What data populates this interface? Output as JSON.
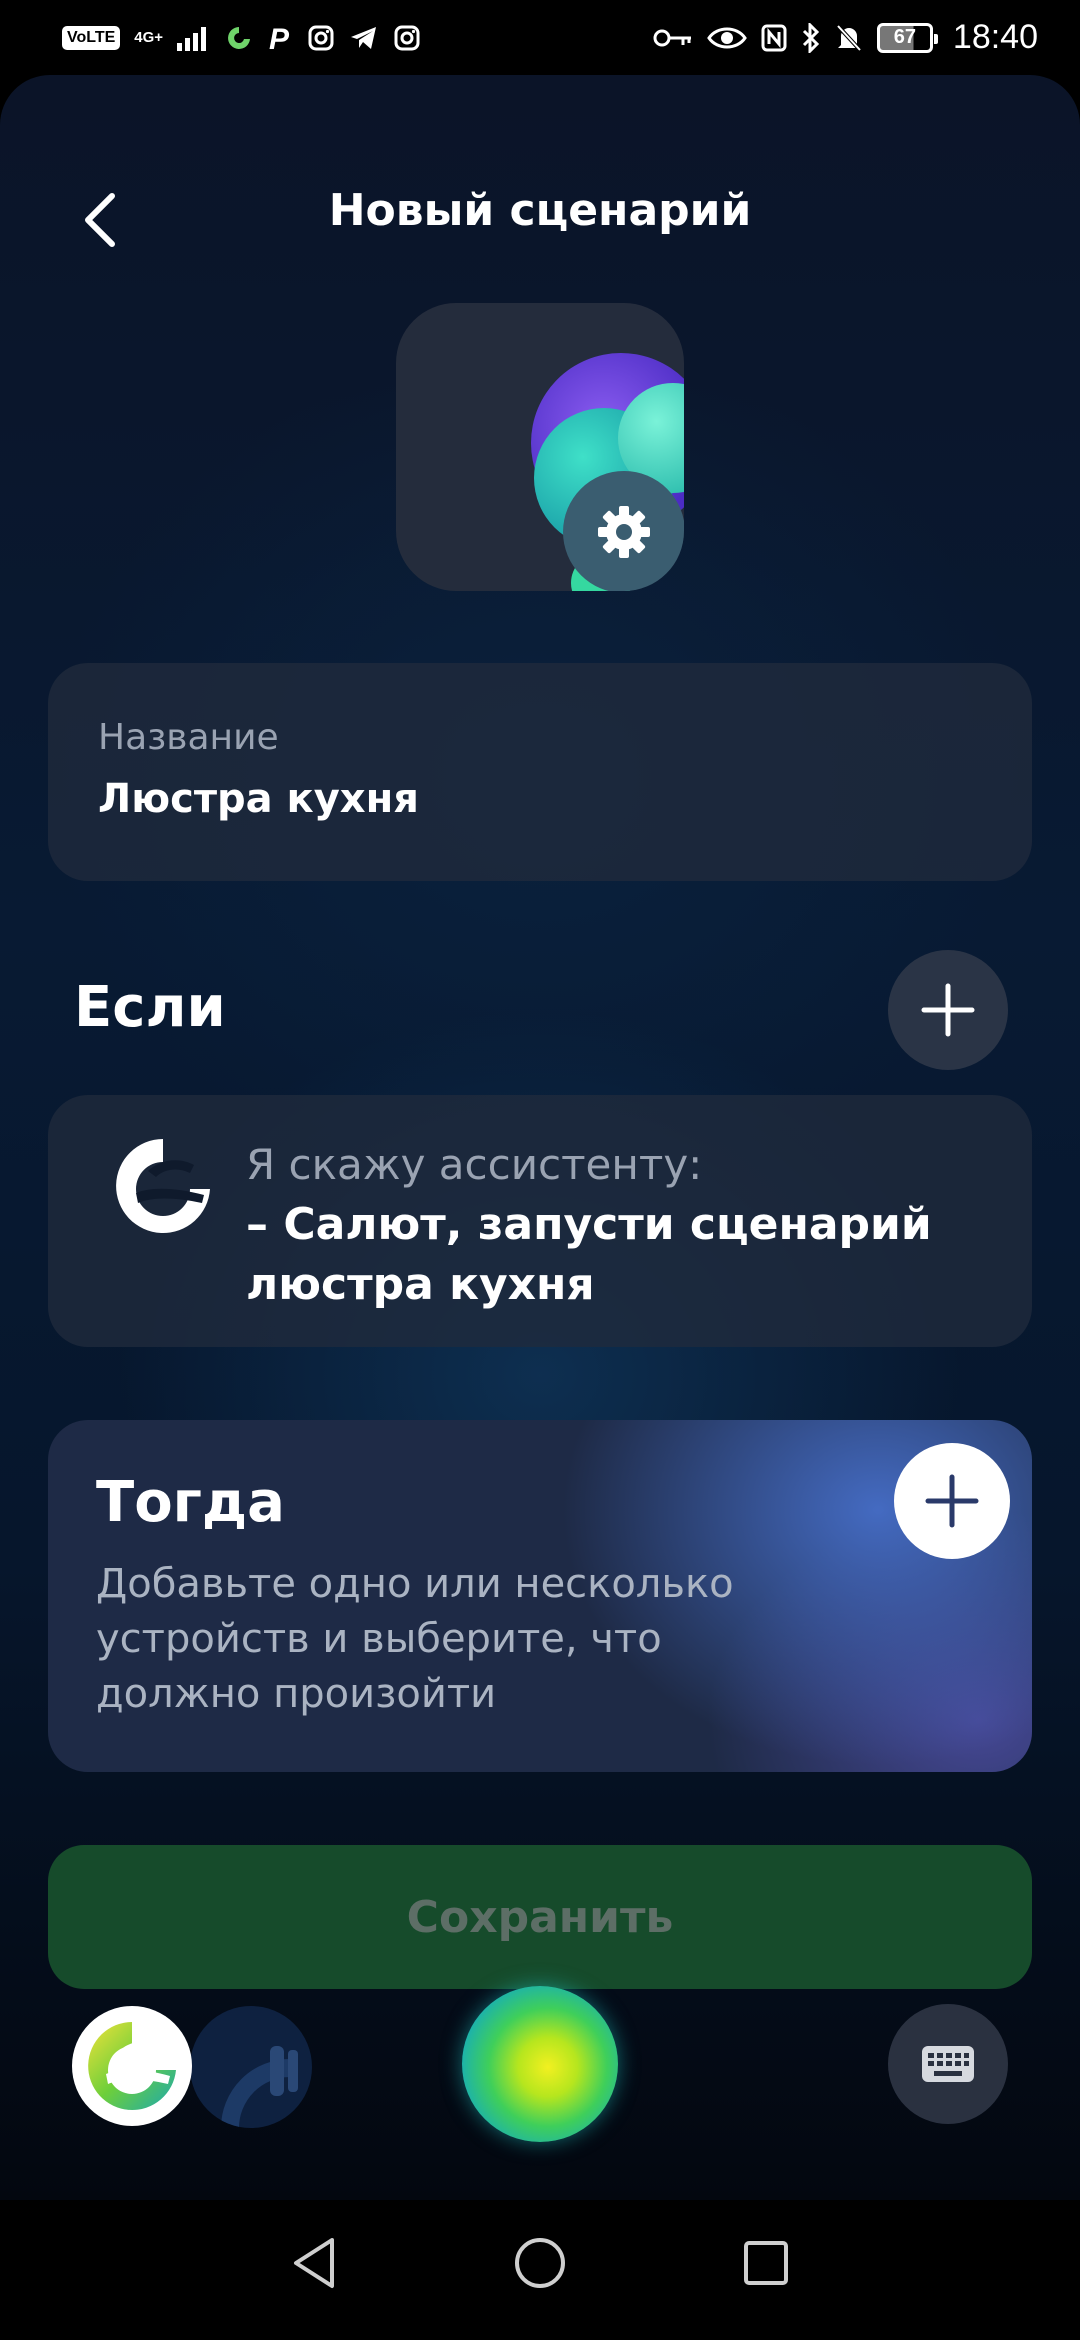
{
  "status_bar": {
    "volte": "VoLTE",
    "network": "4G+",
    "battery": "67",
    "time": "18:40"
  },
  "header": {
    "title": "Новый сценарий"
  },
  "name_field": {
    "label": "Название",
    "value": "Люстра кухня"
  },
  "if_section": {
    "title": "Если",
    "trigger_prefix": "Я скажу ассистенту:",
    "trigger_phrase": "– Салют, запусти сценарий люстра кухня"
  },
  "then_section": {
    "title": "Тогда",
    "description": "Добавьте одно или несколько устройств и выберите, что должно произойти"
  },
  "save_button": {
    "label": "Сохранить"
  },
  "colors": {
    "save_button_bg": "#164b2b",
    "accent_orb": "#b6e61e"
  }
}
